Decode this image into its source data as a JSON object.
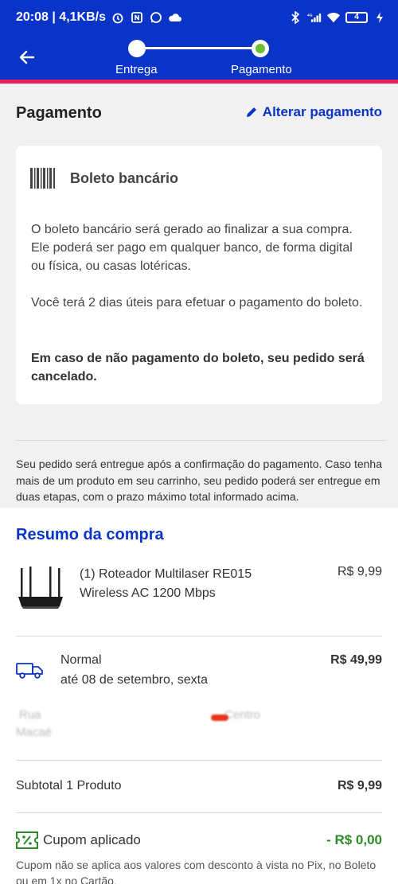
{
  "status_bar": {
    "time_speed": "20:08 | 4,1KB/s",
    "network": "4G",
    "battery": "4"
  },
  "stepper": {
    "step1": "Entrega",
    "step2": "Pagamento"
  },
  "payment": {
    "title": "Pagamento",
    "change_label": "Alterar pagamento",
    "method": "Boleto bancário",
    "paragraph1": "O boleto bancário será gerado ao finalizar a sua compra. Ele poderá ser pago em qualquer banco, de forma digital ou física, ou casas lotéricas.",
    "paragraph2": "Você terá 2 dias úteis para efetuar o pagamento do boleto.",
    "paragraph3": "Em caso de não pagamento do boleto, seu pedido será cancelado.",
    "delivery_note": "Seu pedido será entregue após a confirmação do pagamento. Caso tenha mais de um produto em seu carrinho, seu pedido poderá ser entregue em duas etapas, com o prazo máximo total informado acima."
  },
  "summary": {
    "title": "Resumo da compra",
    "product_name": "(1) Roteador Multilaser RE015 Wireless AC 1200 Mbps",
    "product_price": "R$ 9,99",
    "shipping_type": "Normal",
    "shipping_date": "até 08 de setembro, sexta",
    "shipping_price": "R$ 49,99",
    "address_line1": "Rua",
    "address_line2": "Macaé",
    "address_district": "Centro",
    "subtotal_label": "Subtotal 1 Produto",
    "subtotal_value": "R$ 9,99",
    "coupon_label": "Cupom aplicado",
    "coupon_value": "- R$ 0,00",
    "coupon_note": "Cupom não se aplica aos valores com desconto à vista no Pix, no Boleto ou em 1x no Cartão."
  },
  "colors": {
    "brand_blue": "#0a34c8",
    "accent_red": "#e8215a",
    "step_active": "#6bbf2f",
    "discount_green": "#2e8b2a"
  }
}
